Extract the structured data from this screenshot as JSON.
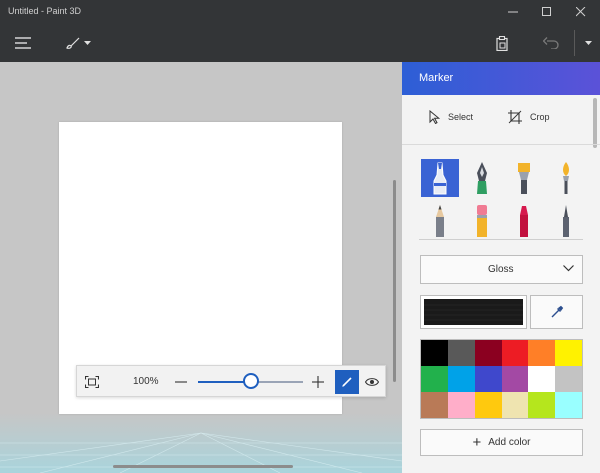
{
  "window": {
    "title": "Untitled - Paint 3D"
  },
  "toolbar": {
    "menu_icon": "hamburger-icon",
    "brush_icon": "brush-icon",
    "paste_icon": "clipboard-icon",
    "undo_icon": "undo-icon"
  },
  "canvas": {
    "zoom": "100%",
    "zoom_level": 0.5
  },
  "panel": {
    "title": "Marker",
    "tools": [
      {
        "label": "Select",
        "icon": "select-cursor-icon"
      },
      {
        "label": "Crop",
        "icon": "crop-icon"
      }
    ],
    "brushes": [
      {
        "name": "marker",
        "selected": true
      },
      {
        "name": "calligraphy-pen",
        "selected": false
      },
      {
        "name": "oil-brush",
        "selected": false
      },
      {
        "name": "watercolor",
        "selected": false
      },
      {
        "name": "pencil",
        "selected": false
      },
      {
        "name": "eraser",
        "selected": false
      },
      {
        "name": "crayon",
        "selected": false
      },
      {
        "name": "pixel-pen",
        "selected": false
      }
    ],
    "finish": "Gloss",
    "add_color_label": "Add color",
    "palette": [
      "#000000",
      "#595959",
      "#8b0020",
      "#ed1c24",
      "#ff7f27",
      "#fff200",
      "#22b14c",
      "#00a2e8",
      "#3f48cc",
      "#a349a4",
      "#ffffff",
      "#c3c3c3",
      "#b97a57",
      "#ffaec9",
      "#ffc90e",
      "#efe4b0",
      "#b5e61d",
      "#99ffff"
    ]
  }
}
